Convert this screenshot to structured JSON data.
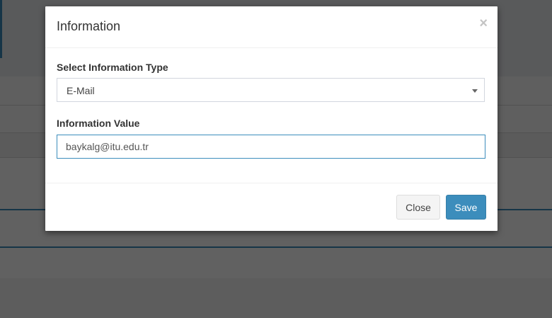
{
  "modal": {
    "title": "Information",
    "close_icon": "×",
    "type_label": "Select Information Type",
    "type_selected": "E-Mail",
    "value_label": "Information Value",
    "value_input": "baykalg@itu.edu.tr",
    "close_button": "Close",
    "save_button": "Save"
  },
  "colors": {
    "primary": "#3c8dbc",
    "overlay": "rgba(0,0,0,0.62)"
  },
  "icons": {
    "close": "close-icon",
    "dropdown": "chevron-down-icon"
  }
}
